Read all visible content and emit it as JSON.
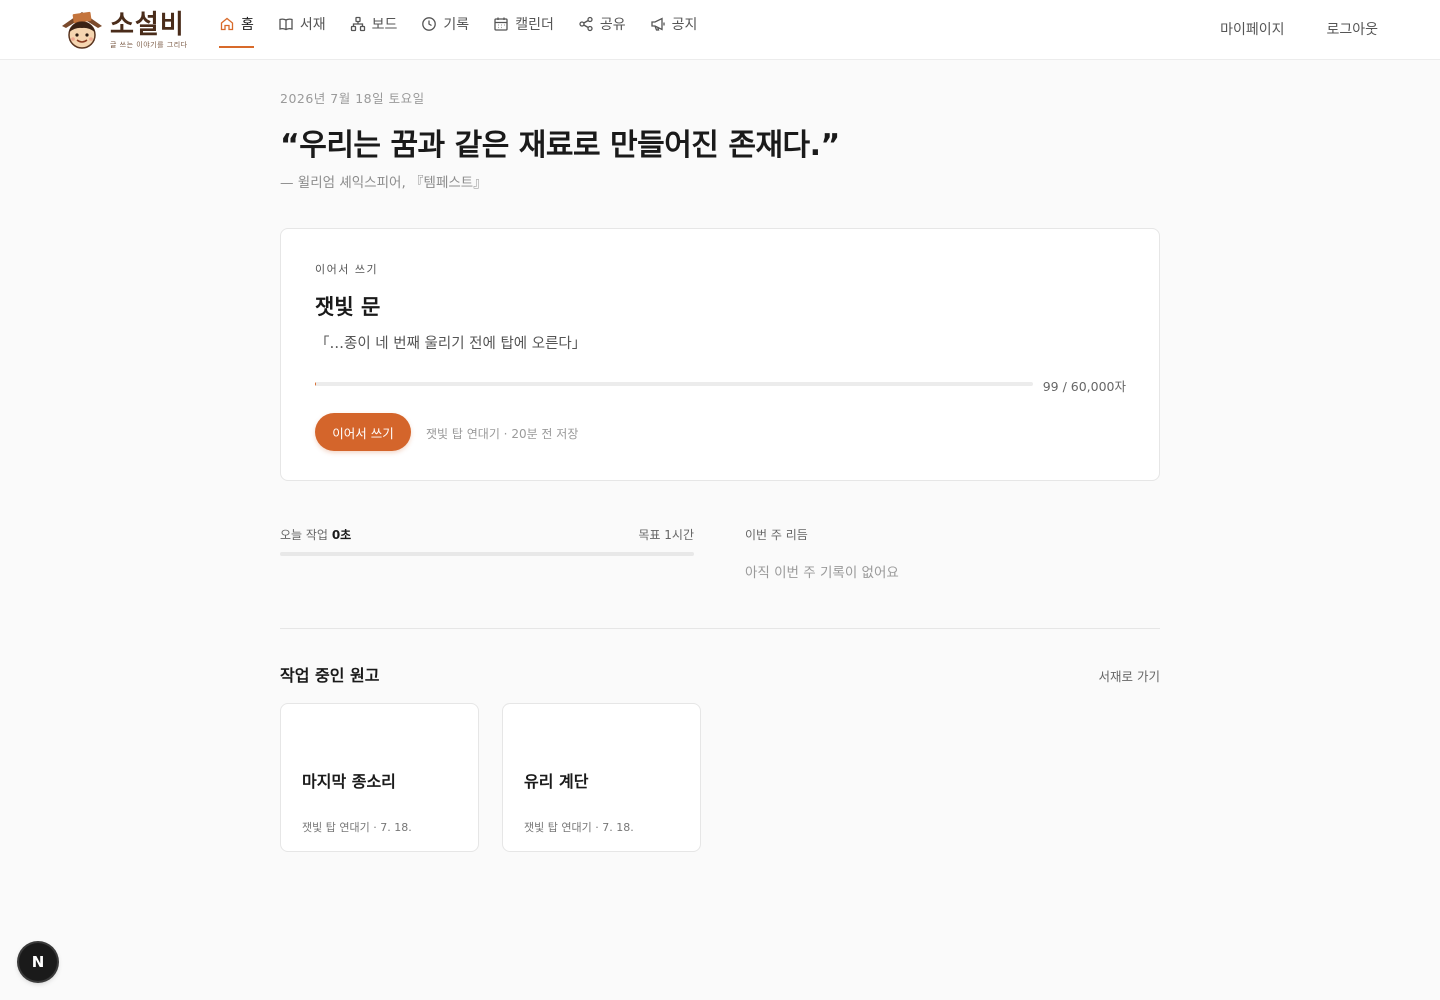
{
  "app": {
    "name": "소설비",
    "tagline": "글 쓰는 이야기를 그리다"
  },
  "nav": {
    "items": [
      {
        "label": "홈",
        "icon": "home-icon",
        "active": true
      },
      {
        "label": "서재",
        "icon": "book-icon",
        "active": false
      },
      {
        "label": "보드",
        "icon": "board-icon",
        "active": false
      },
      {
        "label": "기록",
        "icon": "clock-icon",
        "active": false
      },
      {
        "label": "캘린더",
        "icon": "calendar-icon",
        "active": false
      },
      {
        "label": "공유",
        "icon": "share-icon",
        "active": false
      },
      {
        "label": "공지",
        "icon": "megaphone-icon",
        "active": false
      }
    ],
    "mypage": "마이페이지",
    "logout": "로그아웃"
  },
  "home": {
    "date": "2026년 7월 18일 토요일",
    "quote": "“우리는 꿈과 같은 재료로 만들어진 존재다.”",
    "quote_source": "— 윌리엄 셰익스피어, 『템페스트』"
  },
  "continue_card": {
    "eyebrow": "이어서 쓰기",
    "title": "잿빛 문",
    "excerpt": "「…종이 네 번째 울리기 전에 탑에 오른다」",
    "progress_fraction": 0.00165,
    "progress_label": "99 / 60,000자",
    "button": "이어서 쓰기",
    "meta": "잿빛 탑 연대기 · 20분 전 저장"
  },
  "stats": {
    "today_prefix": "오늘 작업",
    "today_value": "0초",
    "goal": "목표 1시간",
    "today_fraction": 0,
    "week_label": "이번 주 리듬",
    "week_empty": "아직 이번 주 기록이 없어요"
  },
  "manuscripts": {
    "title": "작업 중인 원고",
    "link": "서재로 가기",
    "items": [
      {
        "title": "마지막 종소리",
        "meta": "잿빛 탑 연대기 · 7. 18."
      },
      {
        "title": "유리 계단",
        "meta": "잿빛 탑 연대기 · 7. 18."
      }
    ]
  },
  "fab": {
    "label": "N"
  },
  "colors": {
    "accent": "#d4652b",
    "background": "#fafafa",
    "card": "#ffffff"
  }
}
